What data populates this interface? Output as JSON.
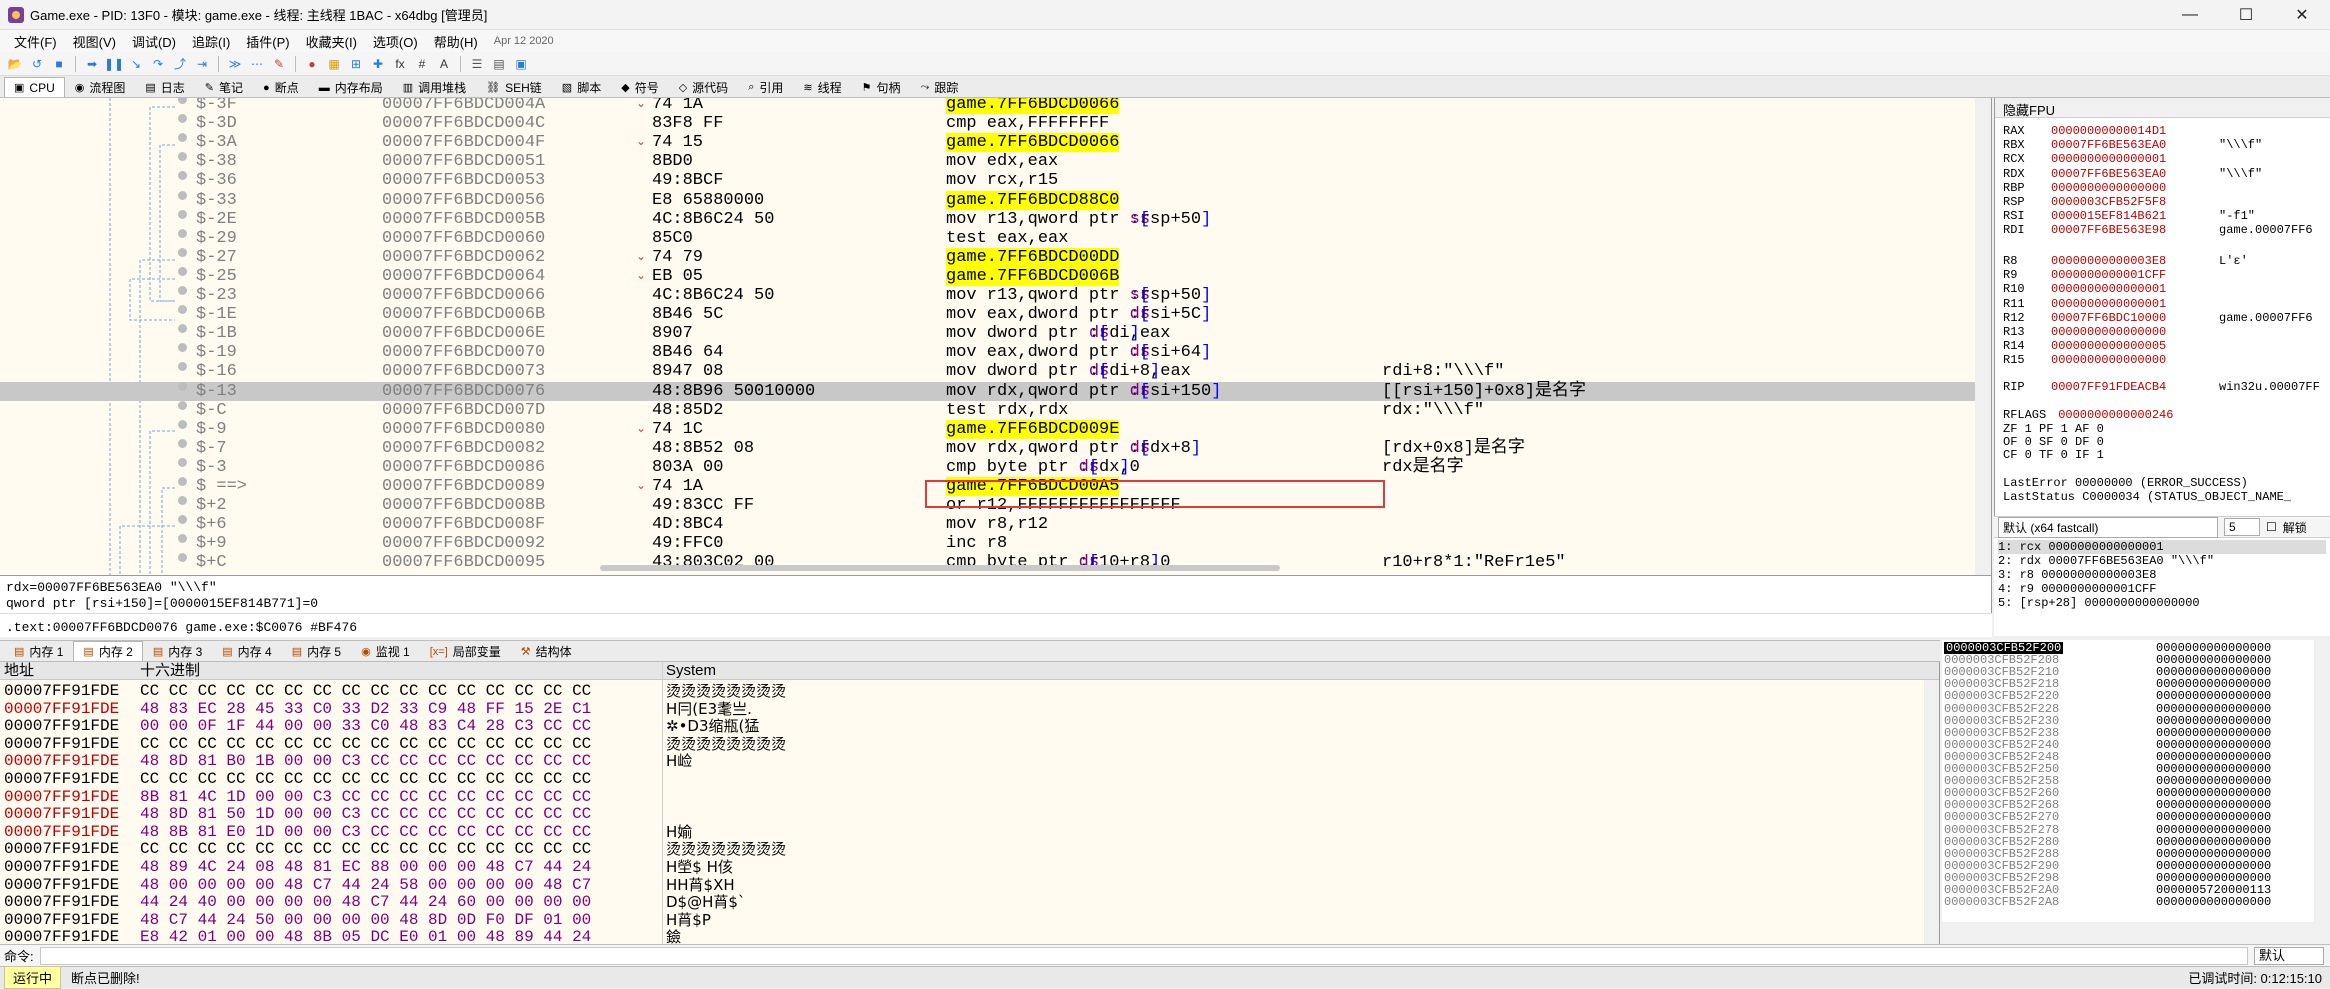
{
  "window": {
    "title": "Game.exe - PID: 13F0 - 模块: game.exe - 线程: 主线程 1BAC - x64dbg [管理员]",
    "min": "—",
    "max": "☐",
    "close": "✕"
  },
  "menu": {
    "items": [
      "文件(F)",
      "视图(V)",
      "调试(D)",
      "追踪(I)",
      "插件(P)",
      "收藏夹(I)",
      "选项(O)",
      "帮助(H)"
    ],
    "date": "Apr 12 2020"
  },
  "toolbar": {
    "icons": [
      "open-icon",
      "restart-icon",
      "stop-icon",
      "run-icon",
      "pause-icon",
      "step-into-icon",
      "step-over-icon",
      "step-out-icon",
      "run-to-user-icon",
      "animate-icon",
      "trace-icon",
      "patch-icon",
      "breakpoint-icon",
      "memory-icon",
      "hardware-icon",
      "label-icon",
      "fx-icon",
      "hash-icon",
      "font-icon",
      "settings-icon",
      "log-icon",
      "calculator-icon"
    ],
    "glyphs": [
      "📂",
      "↺",
      "■",
      "➡",
      "❚❚",
      "↘",
      "↷",
      "⤴",
      "⇥",
      "≫",
      "⋯",
      "✎",
      "●",
      "▦",
      "⊞",
      "✚",
      "fx",
      "#",
      "A",
      "☰",
      "▤",
      "▣"
    ]
  },
  "tabs": [
    {
      "label": "CPU",
      "icon": "▣",
      "name": "cpu-tab-icon",
      "active": true
    },
    {
      "label": "流程图",
      "icon": "◉",
      "name": "graph-tab-icon"
    },
    {
      "label": "日志",
      "icon": "▤",
      "name": "log-tab-icon"
    },
    {
      "label": "笔记",
      "icon": "✎",
      "name": "notes-tab-icon"
    },
    {
      "label": "断点",
      "icon": "●",
      "name": "breakpoints-tab-icon"
    },
    {
      "label": "内存布局",
      "icon": "▬",
      "name": "memory-map-tab-icon"
    },
    {
      "label": "调用堆栈",
      "icon": "▥",
      "name": "call-stack-tab-icon"
    },
    {
      "label": "SEH链",
      "icon": "⛓",
      "name": "seh-tab-icon"
    },
    {
      "label": "脚本",
      "icon": "▧",
      "name": "script-tab-icon"
    },
    {
      "label": "符号",
      "icon": "◆",
      "name": "symbols-tab-icon"
    },
    {
      "label": "源代码",
      "icon": "◇",
      "name": "source-tab-icon"
    },
    {
      "label": "引用",
      "icon": "⌕",
      "name": "references-tab-icon"
    },
    {
      "label": "线程",
      "icon": "≋",
      "name": "threads-tab-icon"
    },
    {
      "label": "句柄",
      "icon": "⚑",
      "name": "handles-tab-icon"
    },
    {
      "label": "跟踪",
      "icon": "⤳",
      "name": "trace-tab-icon"
    }
  ],
  "disasm": [
    {
      "label": "$-3F",
      "addr": "00007FF6BDCD004A",
      "arrow": "⌄",
      "bytes": "74 1A",
      "ins": "je game.7FF6BDCD0066",
      "cmt": ""
    },
    {
      "label": "$-3D",
      "addr": "00007FF6BDCD004C",
      "arrow": "",
      "bytes": "83F8 FF",
      "ins": "cmp eax,FFFFFFFF",
      "cmt": ""
    },
    {
      "label": "$-3A",
      "addr": "00007FF6BDCD004F",
      "arrow": "⌄",
      "bytes": "74 15",
      "ins": "je game.7FF6BDCD0066",
      "cmt": ""
    },
    {
      "label": "$-38",
      "addr": "00007FF6BDCD0051",
      "arrow": "",
      "bytes": "8BD0",
      "ins": "mov edx,eax",
      "cmt": ""
    },
    {
      "label": "$-36",
      "addr": "00007FF6BDCD0053",
      "arrow": "",
      "bytes": "49:8BCF",
      "ins": "mov rcx,r15",
      "cmt": ""
    },
    {
      "label": "$-33",
      "addr": "00007FF6BDCD0056",
      "arrow": "",
      "bytes": "E8 65880000",
      "ins": "call game.7FF6BDCD88C0",
      "cmt": ""
    },
    {
      "label": "$-2E",
      "addr": "00007FF6BDCD005B",
      "arrow": "",
      "bytes": "4C:8B6C24 50",
      "ins": "mov r13,qword ptr ss:[rsp+50]",
      "cmt": ""
    },
    {
      "label": "$-29",
      "addr": "00007FF6BDCD0060",
      "arrow": "",
      "bytes": "85C0",
      "ins": "test eax,eax",
      "cmt": ""
    },
    {
      "label": "$-27",
      "addr": "00007FF6BDCD0062",
      "arrow": "⌄",
      "bytes": "74 79",
      "ins": "je game.7FF6BDCD00DD",
      "cmt": ""
    },
    {
      "label": "$-25",
      "addr": "00007FF6BDCD0064",
      "arrow": "⌄",
      "bytes": "EB 05",
      "ins": "jmp game.7FF6BDCD006B",
      "cmt": ""
    },
    {
      "label": "$-23",
      "addr": "00007FF6BDCD0066",
      "arrow": "",
      "bytes": "4C:8B6C24 50",
      "ins": "mov r13,qword ptr ss:[rsp+50]",
      "cmt": ""
    },
    {
      "label": "$-1E",
      "addr": "00007FF6BDCD006B",
      "arrow": "",
      "bytes": "8B46 5C",
      "ins": "mov eax,dword ptr ds:[rsi+5C]",
      "cmt": ""
    },
    {
      "label": "$-1B",
      "addr": "00007FF6BDCD006E",
      "arrow": "",
      "bytes": "8907",
      "ins": "mov dword ptr ds:[rdi],eax",
      "cmt": ""
    },
    {
      "label": "$-19",
      "addr": "00007FF6BDCD0070",
      "arrow": "",
      "bytes": "8B46 64",
      "ins": "mov eax,dword ptr ds:[rsi+64]",
      "cmt": ""
    },
    {
      "label": "$-16",
      "addr": "00007FF6BDCD0073",
      "arrow": "",
      "bytes": "8947 08",
      "ins": "mov dword ptr ds:[rdi+8],eax",
      "cmt": "rdi+8:\"\\\\\\f\""
    },
    {
      "label": "$-13",
      "addr": "00007FF6BDCD0076",
      "arrow": "",
      "bytes": "48:8B96 50010000",
      "ins": "mov rdx,qword ptr ds:[rsi+150]",
      "cmt": "[[rsi+150]+0x8]是名字"
    },
    {
      "label": "$-C",
      "addr": "00007FF6BDCD007D",
      "arrow": "",
      "bytes": "48:85D2",
      "ins": "test rdx,rdx",
      "cmt": "rdx:\"\\\\\\f\""
    },
    {
      "label": "$-9",
      "addr": "00007FF6BDCD0080",
      "arrow": "⌄",
      "bytes": "74 1C",
      "ins": "je game.7FF6BDCD009E",
      "cmt": ""
    },
    {
      "label": "$-7",
      "addr": "00007FF6BDCD0082",
      "arrow": "",
      "bytes": "48:8B52 08",
      "ins": "mov rdx,qword ptr ds:[rdx+8]",
      "cmt": "[rdx+0x8]是名字"
    },
    {
      "label": "$-3",
      "addr": "00007FF6BDCD0086",
      "arrow": "",
      "bytes": "803A 00",
      "ins": "cmp byte ptr ds:[rdx],0",
      "cmt": "rdx是名字"
    },
    {
      "label": "$ ==>",
      "addr": "00007FF6BDCD0089",
      "arrow": "⌄",
      "bytes": "74 1A",
      "ins": "je game.7FF6BDCD00A5",
      "cmt": ""
    },
    {
      "label": "$+2",
      "addr": "00007FF6BDCD008B",
      "arrow": "",
      "bytes": "49:83CC FF",
      "ins": "or r12,FFFFFFFFFFFFFFFF",
      "cmt": ""
    },
    {
      "label": "$+6",
      "addr": "00007FF6BDCD008F",
      "arrow": "",
      "bytes": "4D:8BC4",
      "ins": "mov r8,r12",
      "cmt": ""
    },
    {
      "label": "$+9",
      "addr": "00007FF6BDCD0092",
      "arrow": "",
      "bytes": "49:FFC0",
      "ins": "inc r8",
      "cmt": ""
    },
    {
      "label": "$+C",
      "addr": "00007FF6BDCD0095",
      "arrow": "",
      "bytes": "43:803C02 00",
      "ins": "cmp byte ptr ds:[r10+r8],0",
      "cmt": "r10+r8*1:\"ReFr1e5\""
    }
  ],
  "info": {
    "line1": "rdx=00007FF6BE563EA0 \"\\\\\\f\"",
    "line2": "qword ptr [rsi+150]=[0000015EF814B771]=0",
    "line3": ".text:00007FF6BDCD0076 game.exe:$C0076 #BF476"
  },
  "regs": {
    "header": "隐藏FPU",
    "gp": [
      {
        "n": "RAX",
        "v": "00000000000014D1",
        "s": ""
      },
      {
        "n": "RBX",
        "v": "00007FF6BE563EA0",
        "s": "\"\\\\\\f\""
      },
      {
        "n": "RCX",
        "v": "0000000000000001",
        "s": ""
      },
      {
        "n": "RDX",
        "v": "00007FF6BE563EA0",
        "s": "\"\\\\\\f\""
      },
      {
        "n": "RBP",
        "v": "0000000000000000",
        "s": ""
      },
      {
        "n": "RSP",
        "v": "0000003CFB52F5F8",
        "s": ""
      },
      {
        "n": "RSI",
        "v": "0000015EF814B621",
        "s": "\"-f1\""
      },
      {
        "n": "RDI",
        "v": "00007FF6BE563E98",
        "s": "game.00007FF6"
      }
    ],
    "ext": [
      {
        "n": "R8",
        "v": "00000000000003E8",
        "s": "L'ε'"
      },
      {
        "n": "R9",
        "v": "0000000000001CFF",
        "s": ""
      },
      {
        "n": "R10",
        "v": "0000000000000001",
        "s": ""
      },
      {
        "n": "R11",
        "v": "0000000000000001",
        "s": ""
      },
      {
        "n": "R12",
        "v": "00007FF6BDC10000",
        "s": "game.00007FF6"
      },
      {
        "n": "R13",
        "v": "0000000000000000",
        "s": ""
      },
      {
        "n": "R14",
        "v": "0000000000000005",
        "s": ""
      },
      {
        "n": "R15",
        "v": "0000000000000000",
        "s": ""
      }
    ],
    "rip": {
      "n": "RIP",
      "v": "00007FF91FDEACB4",
      "s": "win32u.00007FF"
    },
    "rflags": {
      "n": "RFLAGS",
      "v": "0000000000000246"
    },
    "flags": [
      "ZF 1  PF 1  AF 0",
      "OF 0  SF 0  DF 0",
      "CF 0  TF 0  IF 1"
    ],
    "lasterror": "LastError  00000000 (ERROR_SUCCESS)",
    "laststatus": "LastStatus C0000034 (STATUS_OBJECT_NAME_"
  },
  "callconv": {
    "label": "默认 (x64 fastcall)",
    "count": "5",
    "unlock": "解锁"
  },
  "args": [
    "1: rcx 0000000000000001",
    "2: rdx 00007FF6BE563EA0 \"\\\\\\f\"",
    "3: r8 00000000000003E8",
    "4: r9 0000000000001CFF",
    "5: [rsp+28] 0000000000000000"
  ],
  "memtabs": [
    {
      "label": "内存 1",
      "icon": "▤"
    },
    {
      "label": "内存 2",
      "icon": "▤",
      "active": true
    },
    {
      "label": "内存 3",
      "icon": "▤"
    },
    {
      "label": "内存 4",
      "icon": "▤"
    },
    {
      "label": "内存 5",
      "icon": "▤"
    },
    {
      "label": "监视 1",
      "icon": "◉"
    },
    {
      "label": "局部变量",
      "icon": "[x=]"
    },
    {
      "label": "结构体",
      "icon": "⚒"
    }
  ],
  "dump": {
    "headers": {
      "addr": "地址",
      "hex": "十六进制",
      "text": "System"
    },
    "rows": [
      {
        "a": "00007FF91FDE",
        "h": "CC CC CC CC CC CC CC CC CC CC CC CC CC CC CC CC",
        "t": "烫烫烫烫烫烫烫烫",
        "red": false
      },
      {
        "a": "00007FF91FDE",
        "h": "48 83 EC 28 45 33 C0 33 D2 33 C9 48 FF 15 2E C1",
        "t": "H冃(E3耄亗.",
        "red": true
      },
      {
        "a": "00007FF91FDE",
        "h": "00 00 0F 1F 44 00 00 33 C0 48 83 C4 28 C3 CC CC",
        "t": "✲•D3缩瓶(猛",
        "red": false
      },
      {
        "a": "00007FF91FDE",
        "h": "CC CC CC CC CC CC CC CC CC CC CC CC CC CC CC CC",
        "t": "烫烫烫烫烫烫烫烫",
        "red": false
      },
      {
        "a": "00007FF91FDE",
        "h": "48 8D 81 B0 1B 00 00 C3 CC CC CC CC CC CC CC CC",
        "t": "H崄",
        "red": true
      },
      {
        "a": "00007FF91FDE",
        "h": "CC CC CC CC CC CC CC CC CC CC CC CC CC CC CC CC",
        "t": "",
        "red": false
      },
      {
        "a": "00007FF91FDE",
        "h": "8B 81 4C 1D 00 00 C3 CC CC CC CC CC CC CC CC CC",
        "t": "",
        "red": true
      },
      {
        "a": "00007FF91FDE",
        "h": "48 8D 81 50 1D 00 00 C3 CC CC CC CC CC CC CC CC",
        "t": "",
        "red": true
      },
      {
        "a": "00007FF91FDE",
        "h": "48 8B 81 E0 1D 00 00 C3 CC CC CC CC CC CC CC CC",
        "t": "H媮",
        "red": true
      },
      {
        "a": "00007FF91FDE",
        "h": "CC CC CC CC CC CC CC CC CC CC CC CC CC CC CC CC",
        "t": "烫烫烫烫烫烫烫烫",
        "red": false
      },
      {
        "a": "00007FF91FDE",
        "h": "48 89 4C 24 08 48 81 EC 88 00 00 00 48 C7 44 24",
        "t": "H塋$ H侅",
        "red": false
      },
      {
        "a": "00007FF91FDE",
        "h": "48 00 00 00 00 48 C7 44 24 58 00 00 00 00 48 C7",
        "t": "HH莦$XH",
        "red": false
      },
      {
        "a": "00007FF91FDE",
        "h": "44 24 40 00 00 00 00 48 C7 44 24 60 00 00 00 00",
        "t": "D$@H莦$`",
        "red": false
      },
      {
        "a": "00007FF91FDE",
        "h": "48 C7 44 24 50 00 00 00 00 48 8D 0D F0 DF 01 00",
        "t": "H莦$P",
        "red": false
      },
      {
        "a": "00007FF91FDE",
        "h": "E8 42 01 00 00 48 8B 05 DC E0 01 00 48 89 44 24",
        "t": "鐱",
        "red": false
      }
    ]
  },
  "stack": [
    {
      "a": "0000003CFB52F200",
      "v": "0000000000000000",
      "top": true
    },
    {
      "a": "0000003CFB52F208",
      "v": "0000000000000000"
    },
    {
      "a": "0000003CFB52F210",
      "v": "0000000000000000"
    },
    {
      "a": "0000003CFB52F218",
      "v": "0000000000000000"
    },
    {
      "a": "0000003CFB52F220",
      "v": "0000000000000000"
    },
    {
      "a": "0000003CFB52F228",
      "v": "0000000000000000"
    },
    {
      "a": "0000003CFB52F230",
      "v": "0000000000000000"
    },
    {
      "a": "0000003CFB52F238",
      "v": "0000000000000000"
    },
    {
      "a": "0000003CFB52F240",
      "v": "0000000000000000"
    },
    {
      "a": "0000003CFB52F248",
      "v": "0000000000000000"
    },
    {
      "a": "0000003CFB52F250",
      "v": "0000000000000000"
    },
    {
      "a": "0000003CFB52F258",
      "v": "0000000000000000"
    },
    {
      "a": "0000003CFB52F260",
      "v": "0000000000000000"
    },
    {
      "a": "0000003CFB52F268",
      "v": "0000000000000000"
    },
    {
      "a": "0000003CFB52F270",
      "v": "0000000000000000"
    },
    {
      "a": "0000003CFB52F278",
      "v": "0000000000000000"
    },
    {
      "a": "0000003CFB52F280",
      "v": "0000000000000000"
    },
    {
      "a": "0000003CFB52F288",
      "v": "0000000000000000"
    },
    {
      "a": "0000003CFB52F290",
      "v": "0000000000000000"
    },
    {
      "a": "0000003CFB52F298",
      "v": "0000000000000000"
    },
    {
      "a": "0000003CFB52F2A0",
      "v": "0000005720000113"
    },
    {
      "a": "0000003CFB52F2A8",
      "v": "0000000000000000"
    }
  ],
  "cmd": {
    "label": "命令:",
    "default": "默认"
  },
  "status": {
    "state": "运行中",
    "message": "断点已删除!",
    "time": "已调试时间:  0:12:15:10"
  }
}
